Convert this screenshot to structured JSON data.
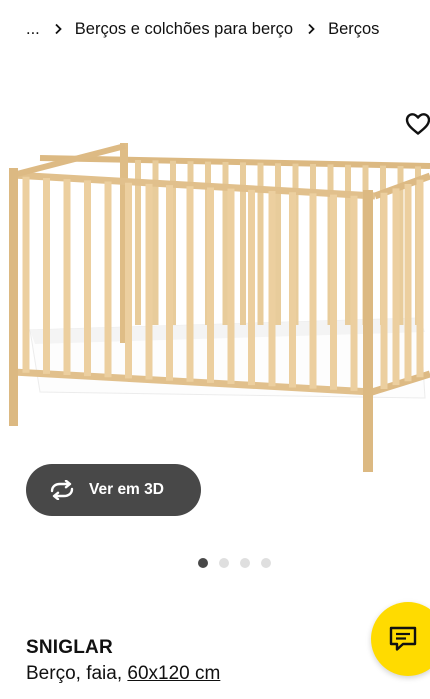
{
  "breadcrumb": {
    "ellipsis": "...",
    "items": [
      "Berços e colchões para berço",
      "Berços"
    ]
  },
  "product": {
    "name": "SNIGLAR",
    "description": "Berço, faia,",
    "size": "60x120 cm"
  },
  "view3d": {
    "label": "Ver em 3D"
  },
  "carousel": {
    "total": 4,
    "active": 1
  },
  "colors": {
    "button_dark": "#484848",
    "chat_yellow": "#ffdb00",
    "wood": "#e7c894"
  },
  "icons": {
    "favorite": "heart-outline-icon",
    "view3d": "rotate-3d-icon",
    "chat": "chat-bubble-icon"
  }
}
